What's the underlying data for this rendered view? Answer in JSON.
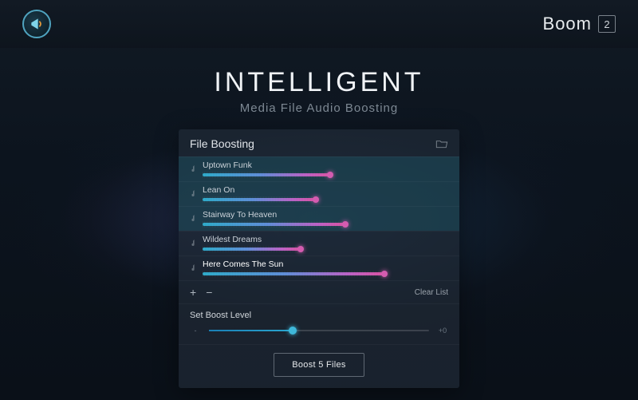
{
  "header": {
    "brand_name": "Boom",
    "brand_version": "2"
  },
  "hero": {
    "title": "INTELLIGENT",
    "subtitle": "Media File Audio Boosting"
  },
  "panel": {
    "title": "File Boosting",
    "tracks": [
      {
        "name": "Uptown Funk",
        "selected": true,
        "active": false,
        "progress": 52
      },
      {
        "name": "Lean On",
        "selected": true,
        "active": false,
        "progress": 46
      },
      {
        "name": "Stairway To Heaven",
        "selected": true,
        "active": false,
        "progress": 58
      },
      {
        "name": "Wildest Dreams",
        "selected": false,
        "active": false,
        "progress": 40
      },
      {
        "name": "Here Comes The Sun",
        "selected": false,
        "active": true,
        "progress": 74
      }
    ],
    "add_label": "+",
    "remove_label": "−",
    "clear_label": "Clear List",
    "boost_level": {
      "label": "Set Boost Level",
      "min_label": "-",
      "max_label": "+0",
      "value_pct": 38
    },
    "action_button": "Boost 5 Files"
  }
}
